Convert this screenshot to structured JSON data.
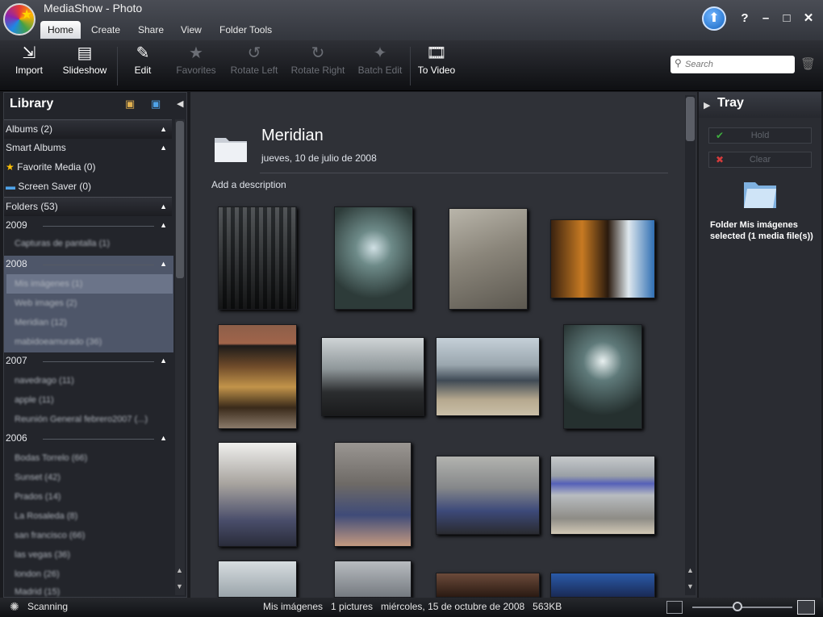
{
  "app": {
    "title": "MediaShow - Photo"
  },
  "tabs": [
    {
      "label": "Home"
    },
    {
      "label": "Create"
    },
    {
      "label": "Share"
    },
    {
      "label": "View"
    },
    {
      "label": "Folder Tools"
    }
  ],
  "window_buttons": {
    "help": "?",
    "minimize": "–",
    "maximize": "□",
    "close": "✕"
  },
  "toolbar": [
    {
      "label": "Import"
    },
    {
      "label": "Slideshow"
    },
    {
      "label": "Edit"
    },
    {
      "label": "Favorites"
    },
    {
      "label": "Rotate Left"
    },
    {
      "label": "Rotate Right"
    },
    {
      "label": "Batch Edit"
    },
    {
      "label": "To Video"
    }
  ],
  "search": {
    "placeholder": "Search"
  },
  "library": {
    "title": "Library",
    "rows": [
      {
        "label": "Albums (2)"
      },
      {
        "label": "Smart Albums"
      },
      {
        "label": "Favorite Media (0)"
      },
      {
        "label": "Screen Saver (0)"
      },
      {
        "label": "Folders (53)"
      },
      {
        "label": "2009"
      },
      {
        "label": "Capturas de pantalla (1)"
      },
      {
        "label": "2008"
      },
      {
        "label": "Mis imágenes (1)"
      },
      {
        "label": "Web images (2)"
      },
      {
        "label": "Meridian (12)"
      },
      {
        "label": "mabidoeamurado (36)"
      },
      {
        "label": "2007"
      },
      {
        "label": "navedrago (11)"
      },
      {
        "label": "apple (11)"
      },
      {
        "label": "Reunión General febrero2007 (...)"
      },
      {
        "label": "2006"
      },
      {
        "label": "Bodas Torrelo (66)"
      },
      {
        "label": "Sunset (42)"
      },
      {
        "label": "Prados (14)"
      },
      {
        "label": "La Rosaleda (8)"
      },
      {
        "label": "san francisco (66)"
      },
      {
        "label": "las vegas (36)"
      },
      {
        "label": "london (26)"
      },
      {
        "label": "Madrid (15)"
      }
    ]
  },
  "main": {
    "folder_title": "Meridian",
    "folder_date": "jueves, 10 de julio de 2008",
    "add_description": "Add a description"
  },
  "tray": {
    "title": "Tray",
    "hold": "Hold",
    "clear": "Clear",
    "info": "Folder Mis imágenes selected (1 media file(s))"
  },
  "status": {
    "scanning": "Scanning",
    "info": "Mis imágenes   1 pictures   miércoles, 15 de octubre de 2008   563KB"
  },
  "zoom": {
    "level": 0.45
  },
  "colors": {
    "accent": "#2f80ed",
    "panel": "#23252b",
    "selection": "#4e5669"
  }
}
